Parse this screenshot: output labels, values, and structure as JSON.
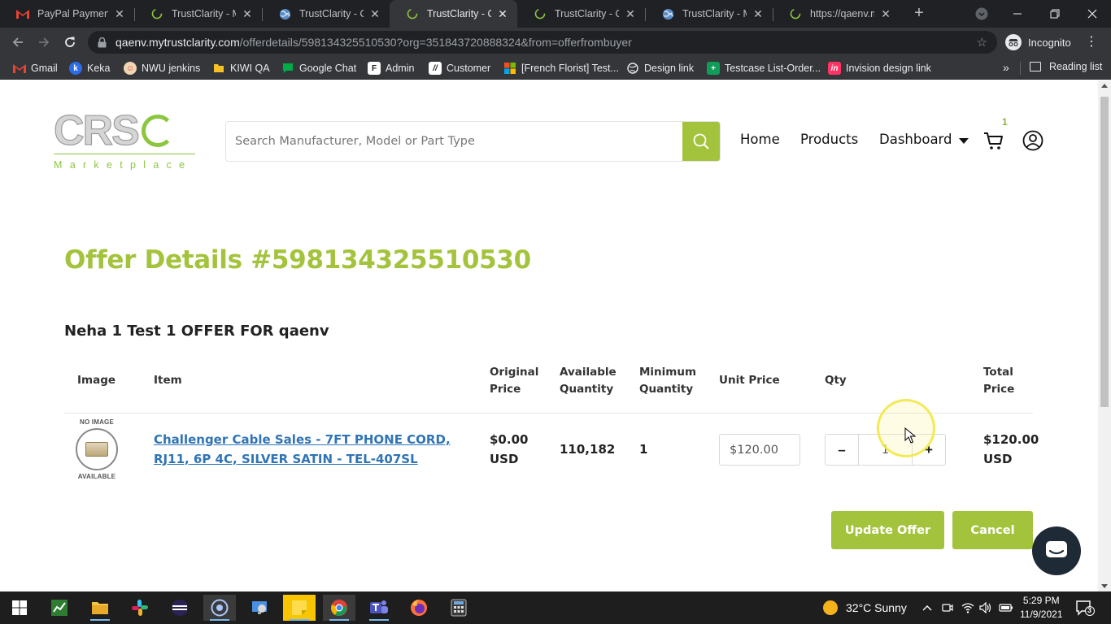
{
  "browser": {
    "tabs": [
      {
        "title": "PayPal Payment In",
        "favicon": "gmail-icon",
        "active": false
      },
      {
        "title": "TrustClarity - My",
        "favicon": "loading-icon",
        "active": false
      },
      {
        "title": "TrustClarity - Offe",
        "favicon": "globe-icon",
        "active": false
      },
      {
        "title": "TrustClarity - Offe",
        "favicon": "loading-icon",
        "active": true
      },
      {
        "title": "TrustClarity - Ord",
        "favicon": "loading-icon",
        "active": false
      },
      {
        "title": "TrustClarity - My",
        "favicon": "globe-icon",
        "active": false
      },
      {
        "title": "https://qaenv.my",
        "favicon": "loading-icon",
        "active": false
      }
    ],
    "url_host": "qaenv.mytrustclarity.com",
    "url_path": "/offerdetails/598134325510530?org=351843720888324&from=offerfrombuyer",
    "profile_label": "Incognito",
    "bookmarks": [
      {
        "label": "Gmail",
        "icon": "gmail-icon",
        "color": "#ea4335"
      },
      {
        "label": "Keka",
        "icon": "keka-icon",
        "color": "#2b6de8"
      },
      {
        "label": "NWU jenkins",
        "icon": "jenkins-icon",
        "color": "#d24939"
      },
      {
        "label": "KIWI QA",
        "icon": "folder-icon",
        "color": "#f6c026"
      },
      {
        "label": "Google Chat",
        "icon": "chat-icon",
        "color": "#00ac47"
      },
      {
        "label": "Admin",
        "icon": "admin-icon",
        "color": "#ffffff"
      },
      {
        "label": "Customer",
        "icon": "customer-icon",
        "color": "#ffffff"
      },
      {
        "label": "[French Florist] Test...",
        "icon": "windows-icon",
        "color": "#f25022"
      },
      {
        "label": "Design link",
        "icon": "globe-icon",
        "color": "#ffffff"
      },
      {
        "label": "Testcase List-Order...",
        "icon": "sheets-icon",
        "color": "#0f9d58"
      },
      {
        "label": "Invision design link",
        "icon": "invision-icon",
        "color": "#ff3366"
      }
    ],
    "more_label": "»",
    "reading_list_label": "Reading list"
  },
  "site": {
    "logo_text": "CRS",
    "logo_sub": "Marketplace",
    "search_placeholder": "Search Manufacturer, Model or Part Type",
    "nav": {
      "home": "Home",
      "products": "Products",
      "dashboard": "Dashboard"
    },
    "cart_count": "1",
    "accent_color": "#a4c33c"
  },
  "offer": {
    "title": "Offer Details #598134325510530",
    "name": "Neha 1 Test 1 OFFER FOR qaenv",
    "columns": {
      "image": "Image",
      "item": "Item",
      "original_price": [
        "Original",
        "Price"
      ],
      "available_quantity": [
        "Available",
        "Quantity"
      ],
      "minimum_quantity": [
        "Minimum",
        "Quantity"
      ],
      "unit_price": "Unit Price",
      "qty": "Qty",
      "total_price": [
        "Total",
        "Price"
      ]
    },
    "rows": [
      {
        "image_text": [
          "NO IMAGE",
          "AVAILABLE"
        ],
        "item": "Challenger Cable Sales - 7FT PHONE CORD, RJ11, 6P 4C, SILVER SATIN - TEL-407SL",
        "original_price": [
          "$0.00",
          "USD"
        ],
        "available_quantity": "110,182",
        "minimum_quantity": "1",
        "unit_price": "$120.00",
        "qty": "1",
        "total_price": [
          "$120.00",
          "USD"
        ]
      }
    ],
    "qty_minus": "–",
    "qty_plus": "+",
    "update_label": "Update Offer",
    "cancel_label": "Cancel"
  },
  "taskbar": {
    "weather": "32°C  Sunny",
    "time": "5:29 PM",
    "date": "11/9/2021",
    "notification_count": "3"
  }
}
